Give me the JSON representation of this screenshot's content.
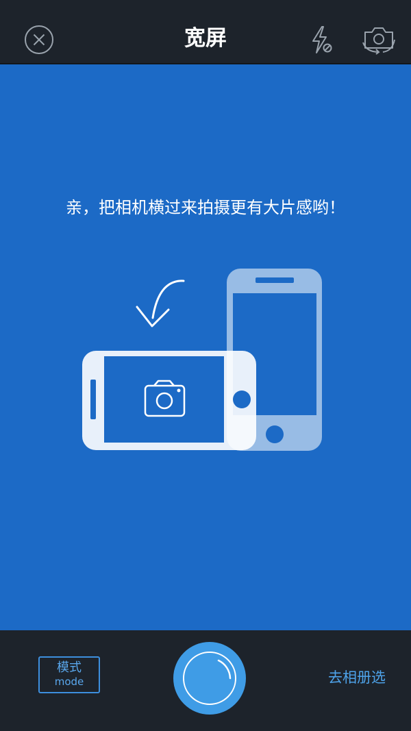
{
  "header": {
    "title": "宽屏",
    "close_icon": "close-circle-icon",
    "flash_icon": "flash-off-icon",
    "flip_icon": "camera-switch-icon"
  },
  "main": {
    "hint": "亲，把相机横过来拍摄更有大片感哟！",
    "illustration_icons": [
      "rotate-arrow-icon",
      "phone-landscape-icon",
      "phone-portrait-icon",
      "camera-icon"
    ]
  },
  "footer": {
    "mode_cn": "模式",
    "mode_en": "mode",
    "shutter_icon": "shutter-icon",
    "album": "去相册选"
  },
  "colors": {
    "bar": "#1d232b",
    "viewfinder": "#1c6ac6",
    "accent": "#3f9ce6",
    "link": "#4ea3ea"
  }
}
